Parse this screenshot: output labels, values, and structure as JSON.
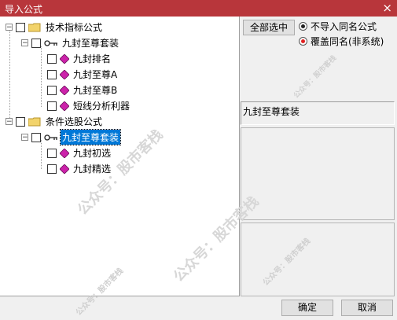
{
  "window": {
    "title": "导入公式",
    "close_glyph": "×"
  },
  "tree": {
    "root1": {
      "label": "技术指标公式",
      "group": {
        "label": "九封至尊套装",
        "items": [
          "九封排名",
          "九封至尊A",
          "九封至尊B",
          "短线分析利器"
        ]
      }
    },
    "root2": {
      "label": "条件选股公式",
      "group": {
        "label": "九封至尊套装",
        "items": [
          "九封初选",
          "九封精选"
        ]
      }
    }
  },
  "right": {
    "select_all": "全部选中",
    "radio_no_import": "不导入同名公式",
    "radio_overwrite": "覆盖同名(非系统)",
    "selected_name": "九封至尊套装"
  },
  "footer": {
    "ok": "确定",
    "cancel": "取消"
  },
  "watermark": "公众号：股市客栈",
  "colors": {
    "title_bar": "#b8363b",
    "selection": "#0078d7",
    "diamond": "#cc22aa",
    "folder": "#f2d36b"
  }
}
